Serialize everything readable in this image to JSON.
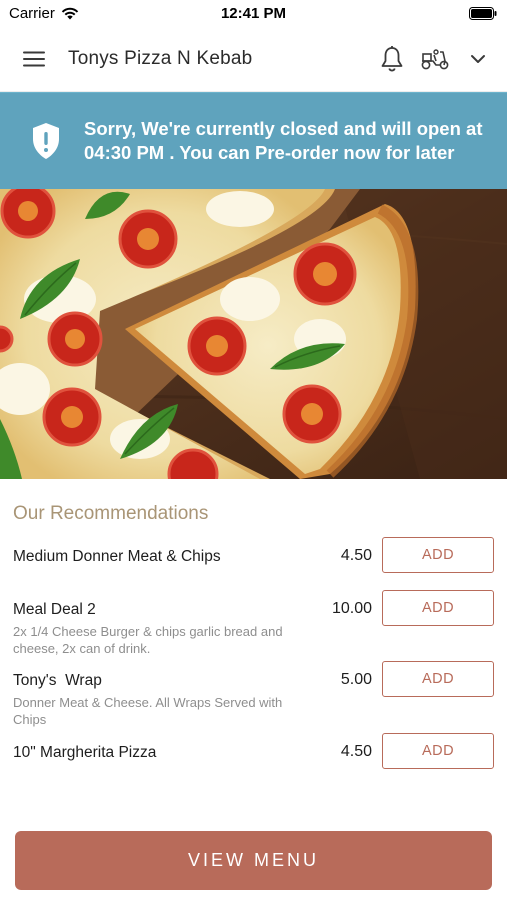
{
  "status_bar": {
    "carrier": "Carrier",
    "time": "12:41 PM"
  },
  "header": {
    "title": "Tonys Pizza N Kebab",
    "icons": [
      "menu-icon",
      "bell-icon",
      "scooter-icon",
      "chevron-down-icon"
    ]
  },
  "banner": {
    "icon": "shield-alert-icon",
    "message": "Sorry, We're currently closed and will open at 04:30 PM . You can Pre-order now for later",
    "color": "#5fa3bd"
  },
  "hero": {
    "image": "pizza-margherita-photo"
  },
  "recommendations": {
    "title": "Our Recommendations",
    "items": [
      {
        "name": "Medium Donner Meat & Chips",
        "description": "",
        "price": "4.50",
        "button": "ADD"
      },
      {
        "name": "Meal Deal 2",
        "description": "2x 1/4 Cheese Burger & chips garlic bread and cheese, 2x can of drink.",
        "price": "10.00",
        "button": "ADD"
      },
      {
        "name": "Tony's  Wrap",
        "description": "Donner Meat & Cheese. All Wraps Served with Chips",
        "price": "5.00",
        "button": "ADD"
      },
      {
        "name": "10\" Margherita Pizza",
        "description": "",
        "price": "4.50",
        "button": "ADD"
      }
    ]
  },
  "footer": {
    "view_menu_label": "VIEW MENU"
  },
  "colors": {
    "accent": "#b86b5a",
    "section_title": "#a99576",
    "banner": "#5fa3bd"
  }
}
